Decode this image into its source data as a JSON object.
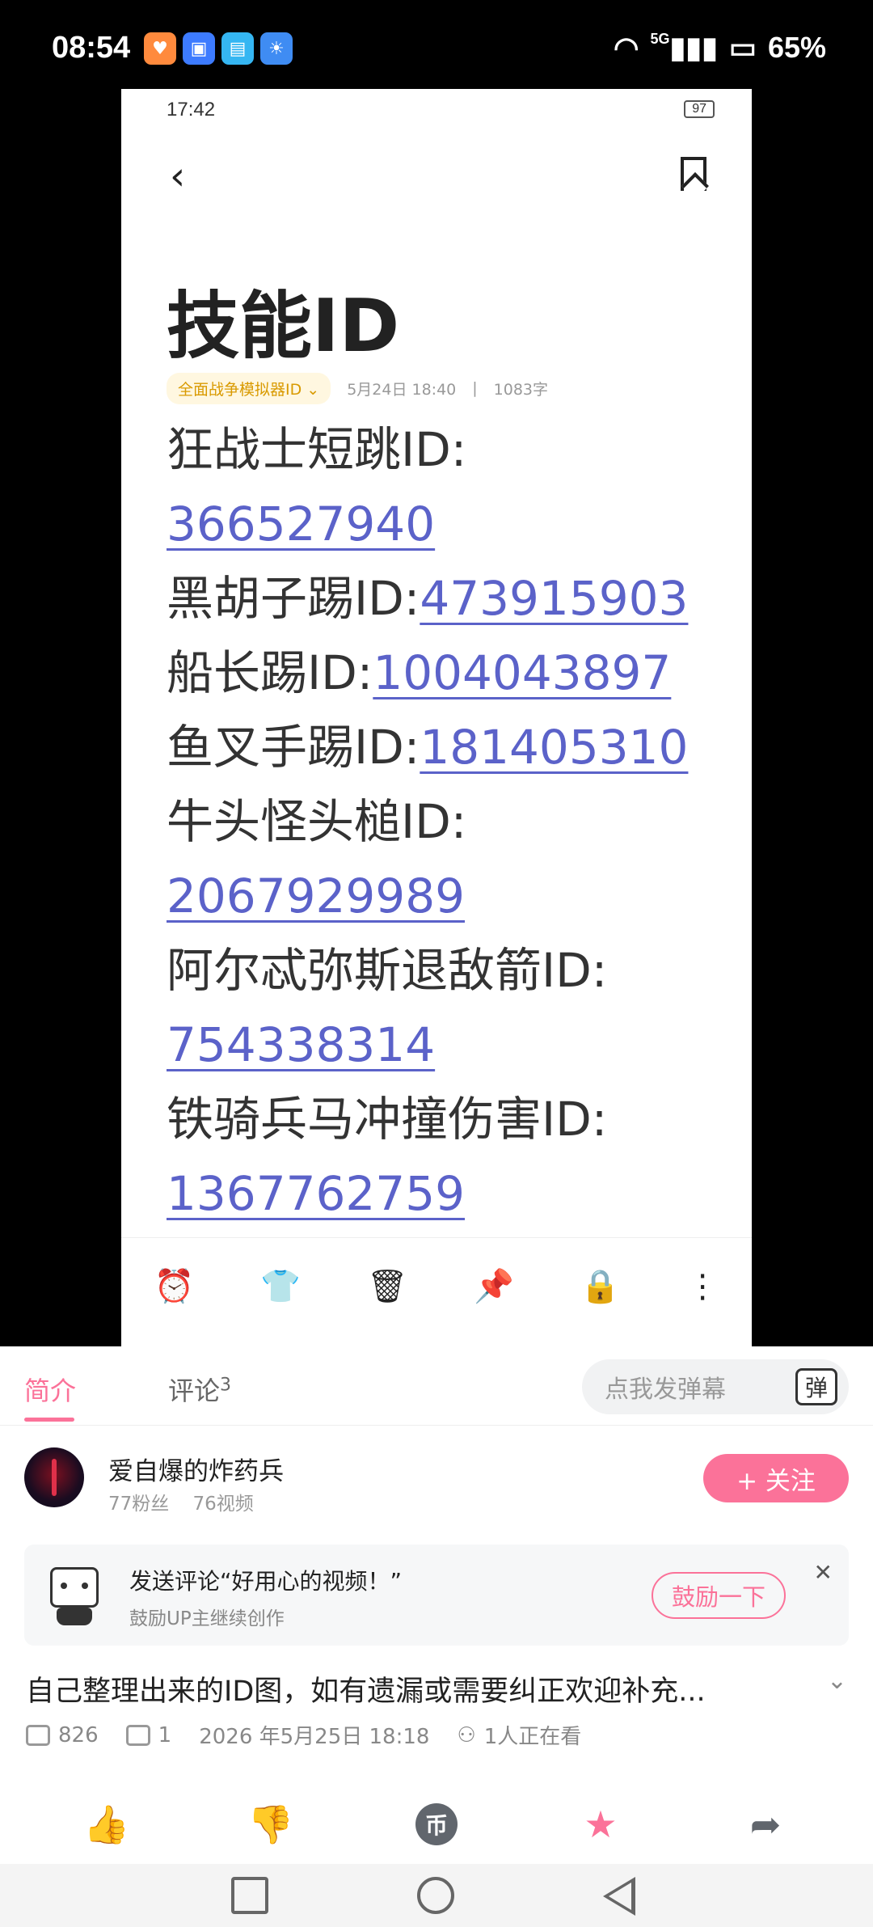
{
  "status_bar": {
    "time": "08:54",
    "network": "5G",
    "battery": "65%"
  },
  "video_frame": {
    "inner_time": "17:42",
    "inner_battery": "97",
    "note": {
      "title": "技能ID",
      "folder": "全面战争模拟器ID",
      "date": "5月24日 18:40",
      "separator": "|",
      "word_count": "1083字",
      "lines": [
        {
          "label": "狂战士短跳ID:",
          "id": ""
        },
        {
          "label": "",
          "id": "366527940"
        },
        {
          "label": "黑胡子踢ID:",
          "id": "473915903"
        },
        {
          "label": "船长踢ID:",
          "id": "1004043897"
        },
        {
          "label": "鱼叉手踢ID:",
          "id": "181405310"
        },
        {
          "label": "牛头怪头槌ID:",
          "id": ""
        },
        {
          "label": "",
          "id": "2067929989"
        },
        {
          "label": "阿尔忒弥斯退敌箭ID:",
          "id": ""
        },
        {
          "label": "",
          "id": "754338314"
        },
        {
          "label": "铁骑兵马冲撞伤害ID:",
          "id": ""
        },
        {
          "label": "",
          "id": "1367762759"
        }
      ]
    }
  },
  "tabs": {
    "intro": "简介",
    "comments": "评论",
    "comments_count": "3"
  },
  "danmaku": {
    "placeholder": "点我发弹幕",
    "icon_text": "弹"
  },
  "author": {
    "name": "爱自爆的炸药兵",
    "fans": "77粉丝",
    "videos": "76视频",
    "follow_label": "+ 关注"
  },
  "comment_prompt": {
    "title": "发送评论“好用心的视频！”",
    "subtitle": "鼓励UP主继续创作",
    "button": "鼓励一下",
    "close": "✕"
  },
  "video_info": {
    "title": "自己整理出来的ID图，如有遗漏或需要纠正欢迎补充...",
    "views": "826",
    "danmaku_count": "1",
    "date": "2026 年5月25日 18:18",
    "watching": "1人正在看"
  },
  "colors": {
    "accent": "#fb7299",
    "link": "#5b62c9",
    "icon_gray": "#61666d"
  }
}
